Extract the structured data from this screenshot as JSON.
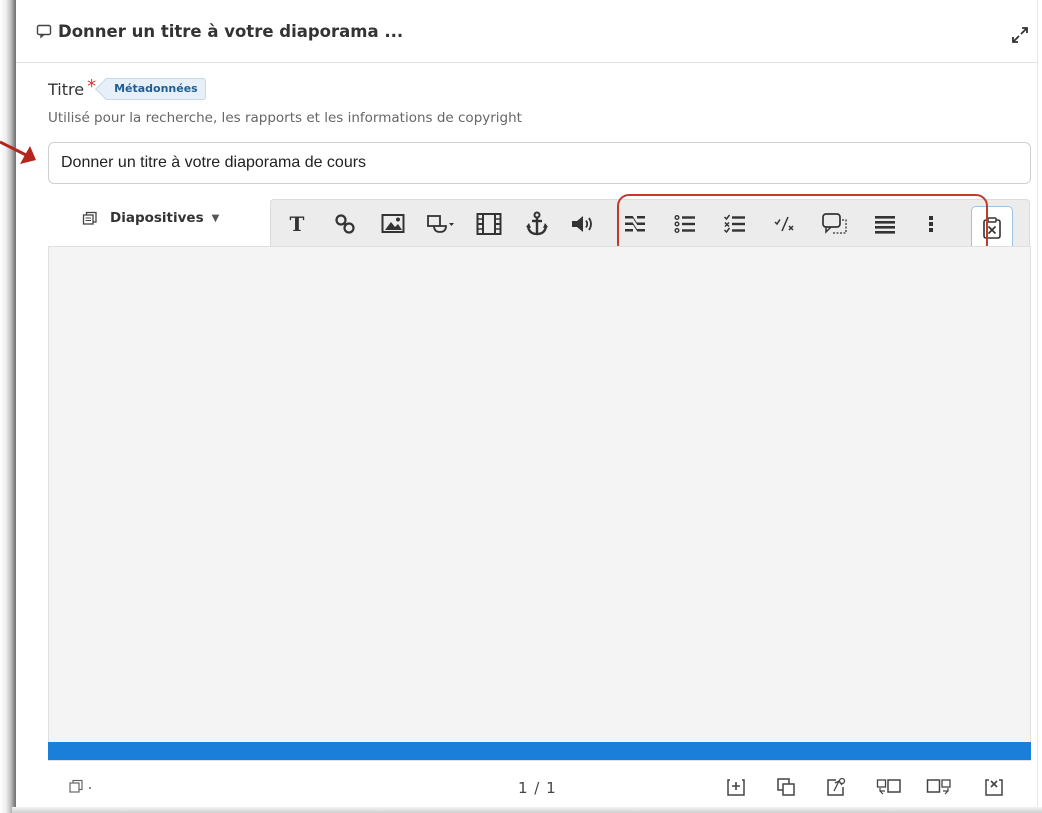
{
  "header": {
    "title": "Donner un titre à votre diaporama ..."
  },
  "field": {
    "label": "Titre",
    "required_mark": "*",
    "badge": "Métadonnées",
    "help": "Utilisé pour la recherche, les rapports et les informations de copyright",
    "value": "Donner un titre à votre diaporama de cours"
  },
  "toolbar": {
    "slides_label": "Diapositives",
    "tools": [
      "text-icon",
      "link-icon",
      "image-icon",
      "shape-icon",
      "video-icon",
      "anchor-icon",
      "audio-icon",
      "dual-list-icon",
      "bullet-list-icon",
      "checklist-icon",
      "fraction-icon",
      "speech-bubble-icon",
      "lines-icon",
      "vertical-dots-icon",
      "clipboard-x-icon"
    ]
  },
  "footer": {
    "page_counter": "1 / 1"
  },
  "colors": {
    "accent": "#1a7fd9",
    "highlight": "#c0392b",
    "required": "#d9322c",
    "badge_text": "#1f5e96"
  }
}
